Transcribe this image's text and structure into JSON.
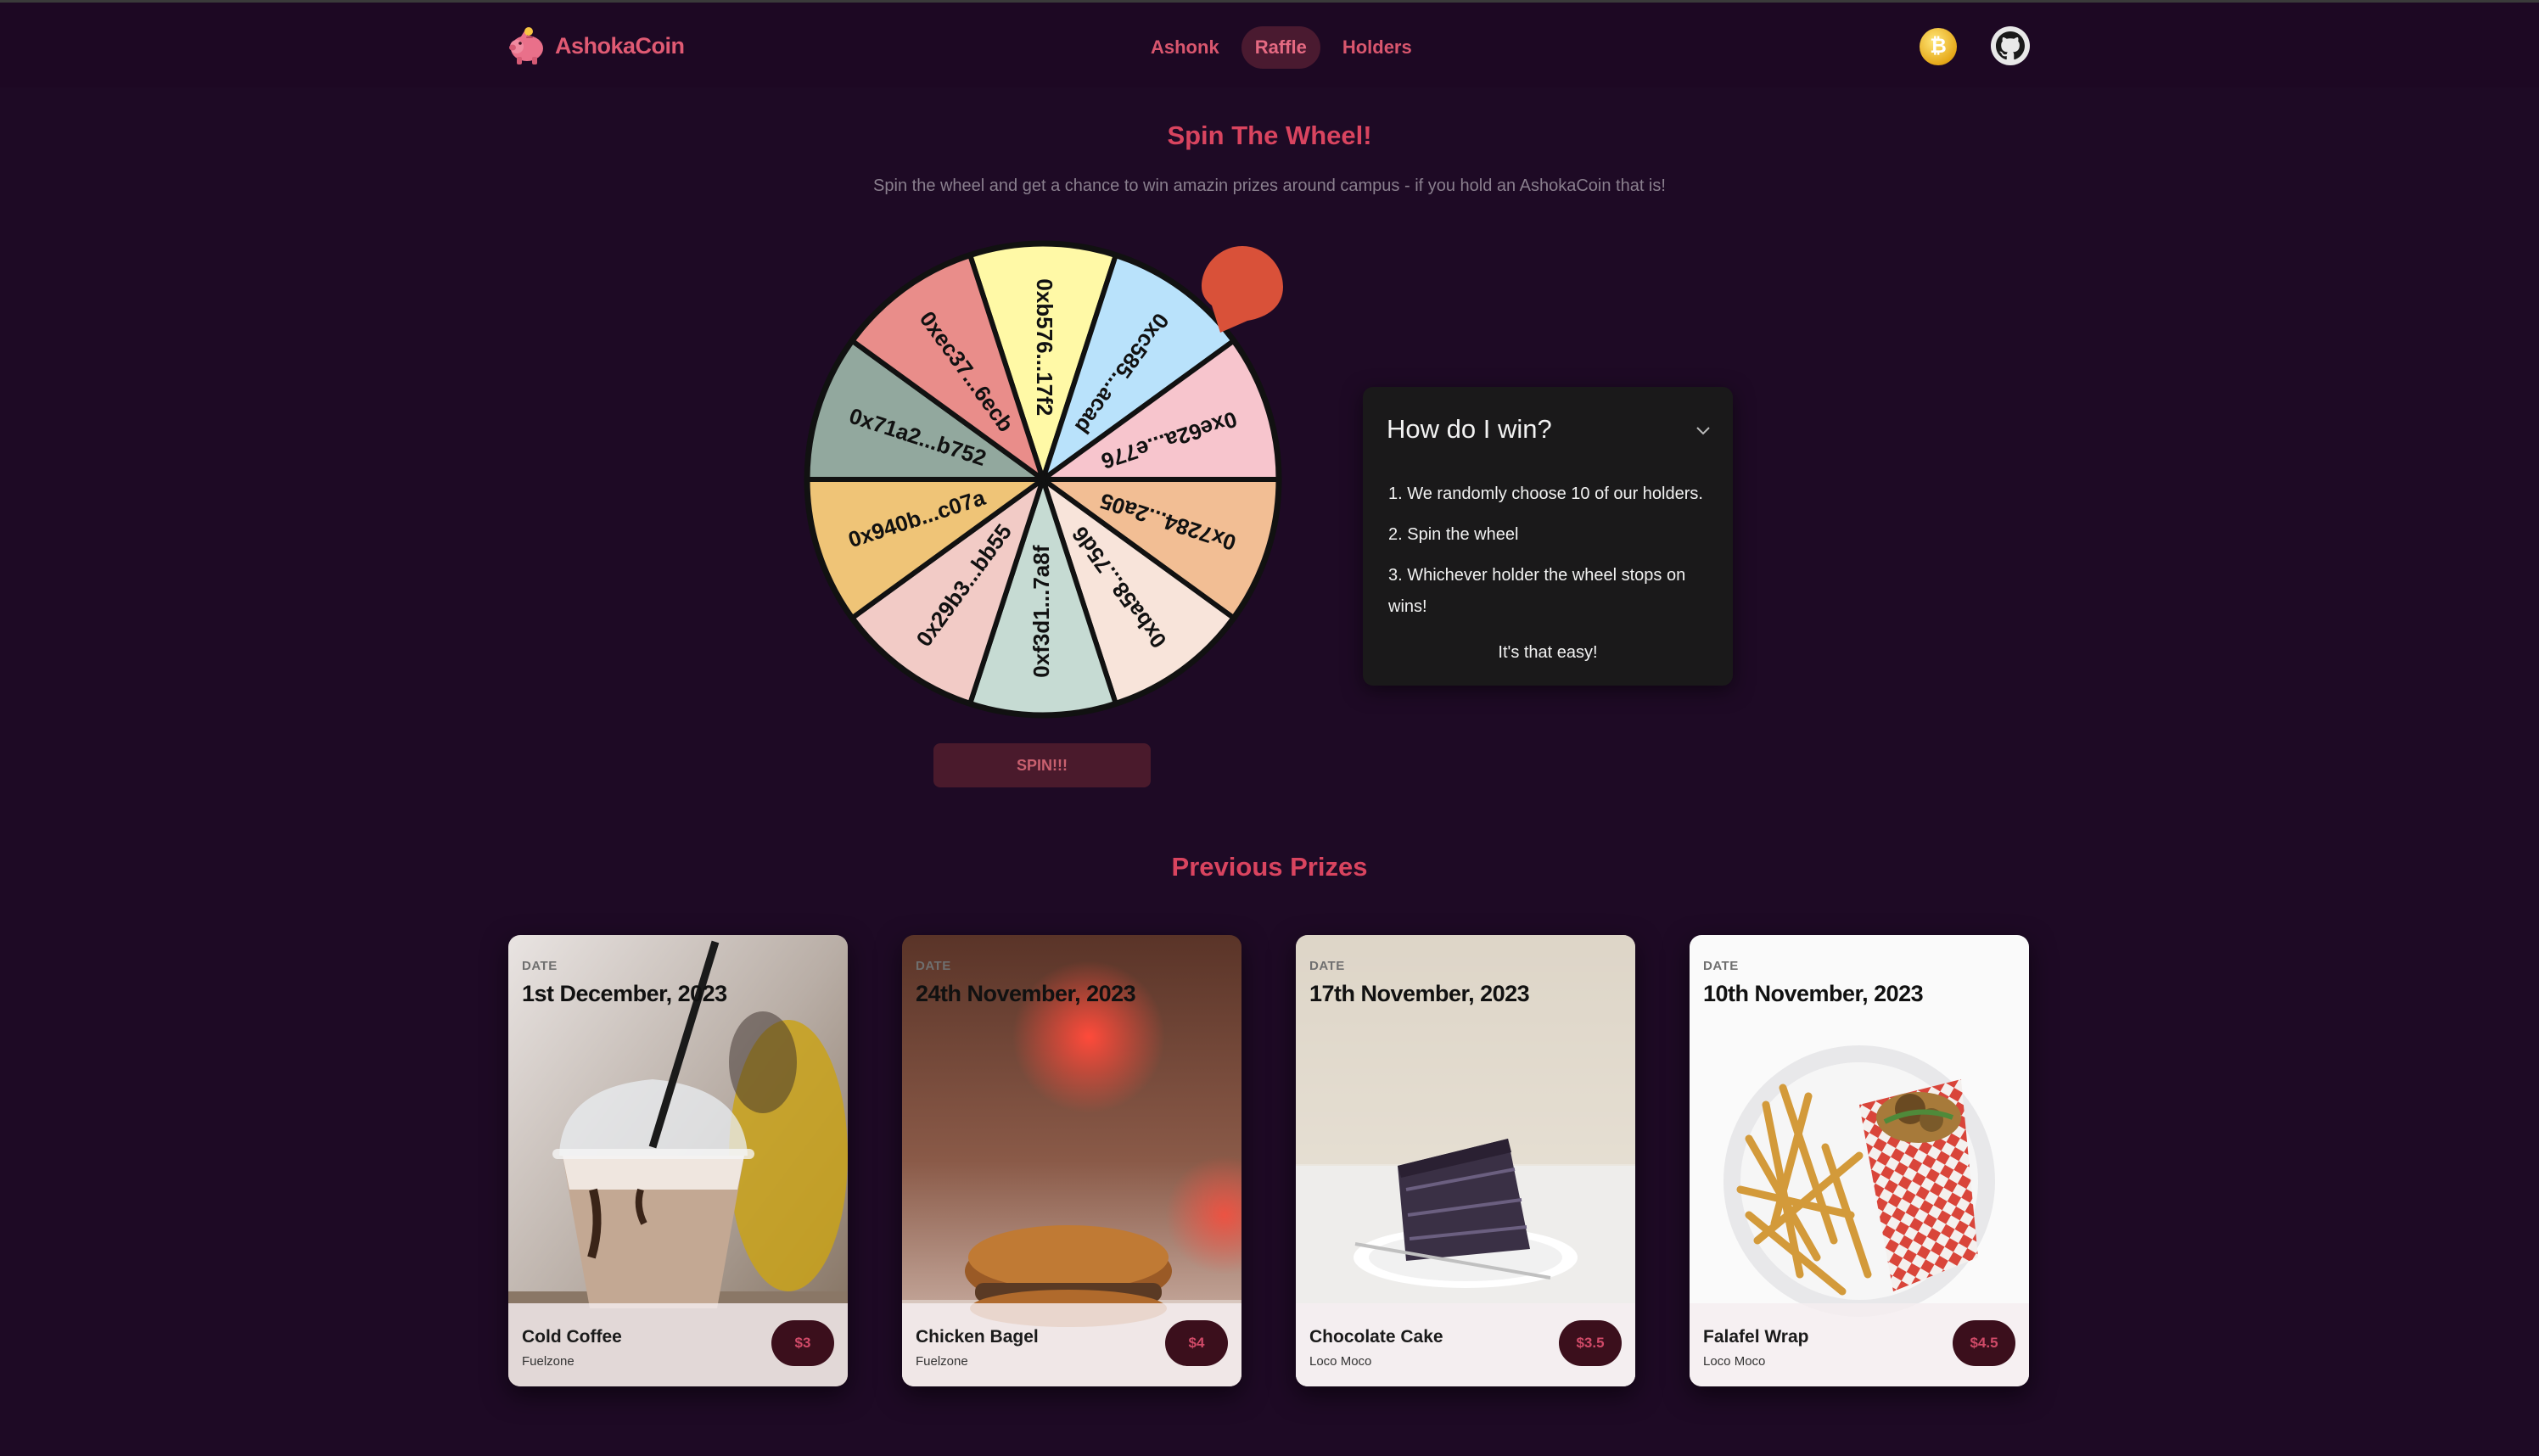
{
  "brand": {
    "name": "AshokaCoin"
  },
  "nav": {
    "links": [
      "Ashonk",
      "Raffle",
      "Holders"
    ],
    "active": "Raffle"
  },
  "header_icons": {
    "coin": "bitcoin-icon",
    "github": "github-icon"
  },
  "raffle": {
    "title": "Spin The Wheel!",
    "subtitle": "Spin the wheel and get a chance to win amazin prizes around campus - if you hold an AshokaCoin that is!",
    "wheel_segments": [
      {
        "label": "0xb576...17f2",
        "color": "#fff9a6"
      },
      {
        "label": "0xc585...acad",
        "color": "#b9e2fb"
      },
      {
        "label": "0xe62a...e776",
        "color": "#f7c5cd"
      },
      {
        "label": "0x7284...2a05",
        "color": "#f2be94"
      },
      {
        "label": "0xba58...75d6",
        "color": "#f8e4da"
      },
      {
        "label": "0xf3d1...7a8f",
        "color": "#c6dbd3"
      },
      {
        "label": "0x29b3...bb55",
        "color": "#f2cbc6"
      },
      {
        "label": "0x940b...c07a",
        "color": "#efc477"
      },
      {
        "label": "0x71a2...b752",
        "color": "#92a89e"
      },
      {
        "label": "0xec37...6ecb",
        "color": "#e98d8a"
      }
    ],
    "spin_button": "SPIN!!!",
    "pointer_color": "#d95139"
  },
  "how_to_win": {
    "title": "How do I win?",
    "steps": [
      "1. We randomly choose 10 of our holders.",
      "2. Spin the wheel",
      "3. Whichever holder the wheel stops on wins!"
    ],
    "footer": "It's that easy!"
  },
  "previous_prizes": {
    "title": "Previous Prizes",
    "date_label": "DATE",
    "cards": [
      {
        "date": "1st December, 2023",
        "name": "Cold Coffee",
        "place": "Fuelzone",
        "price": "$3"
      },
      {
        "date": "24th November, 2023",
        "name": "Chicken Bagel",
        "place": "Fuelzone",
        "price": "$4"
      },
      {
        "date": "17th November, 2023",
        "name": "Chocolate Cake",
        "place": "Loco Moco",
        "price": "$3.5"
      },
      {
        "date": "10th November, 2023",
        "name": "Falafel Wrap",
        "place": "Loco Moco",
        "price": "$4.5"
      }
    ]
  },
  "colors": {
    "background": "#1e0a25",
    "accent": "#d9445f",
    "card_dark": "#1a191a"
  }
}
